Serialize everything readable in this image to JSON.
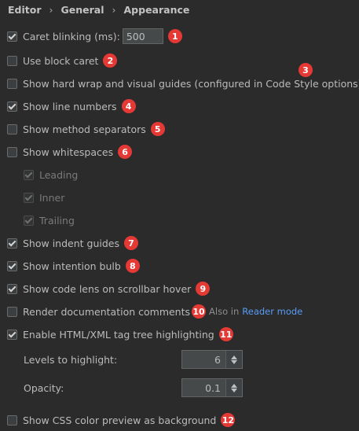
{
  "breadcrumb": [
    "Editor",
    "General",
    "Appearance"
  ],
  "caret_blinking": {
    "label": "Caret blinking (ms):",
    "checked": true,
    "value": "500",
    "badge": "1"
  },
  "block_caret": {
    "label": "Use block caret",
    "checked": false,
    "badge": "2"
  },
  "hard_wrap": {
    "label": "Show hard wrap and visual guides (configured in Code Style options)",
    "checked": false,
    "badge": "3"
  },
  "line_numbers": {
    "label": "Show line numbers",
    "checked": true,
    "badge": "4"
  },
  "method_separators": {
    "label": "Show method separators",
    "checked": false,
    "badge": "5"
  },
  "whitespaces": {
    "label": "Show whitespaces",
    "checked": false,
    "badge": "6"
  },
  "whitespace_sub": {
    "leading": "Leading",
    "inner": "Inner",
    "trailing": "Trailing"
  },
  "indent_guides": {
    "label": "Show indent guides",
    "checked": true,
    "badge": "7"
  },
  "intention_bulb": {
    "label": "Show intention bulb",
    "checked": true,
    "badge": "8"
  },
  "code_lens": {
    "label": "Show code lens on scrollbar hover",
    "checked": true,
    "badge": "9"
  },
  "render_docs": {
    "label": "Render documentation comments",
    "checked": false,
    "badge": "10",
    "also_text": "Also in",
    "link_text": "Reader mode"
  },
  "tag_tree": {
    "label": "Enable HTML/XML tag tree highlighting",
    "checked": true,
    "badge": "11"
  },
  "levels": {
    "label": "Levels to highlight:",
    "value": "6"
  },
  "opacity": {
    "label": "Opacity:",
    "value": "0.1"
  },
  "css_preview": {
    "label": "Show CSS color preview as background",
    "checked": false,
    "badge": "12"
  },
  "colors": {
    "background": "#2b2b2b",
    "badge": "#e53935",
    "link": "#589df6",
    "text": "#bbbbbb"
  }
}
